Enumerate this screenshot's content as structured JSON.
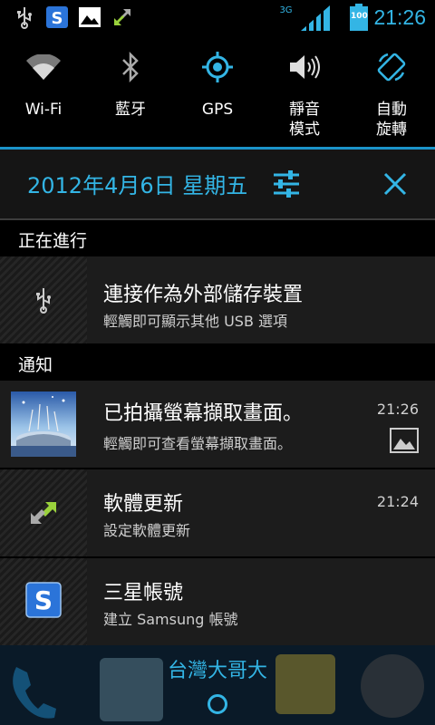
{
  "status_bar": {
    "network": "3G",
    "battery": "100",
    "time": "21:26"
  },
  "toggles": [
    {
      "label": "Wi-Fi",
      "icon": "wifi-icon"
    },
    {
      "label": "藍牙",
      "icon": "bluetooth-icon"
    },
    {
      "label": "GPS",
      "icon": "gps-icon"
    },
    {
      "label": "靜音\n模式",
      "icon": "volume-icon"
    },
    {
      "label": "自動\n旋轉",
      "icon": "rotate-icon"
    }
  ],
  "header": {
    "date": "2012年4月6日 星期五"
  },
  "sections": {
    "ongoing": "正在進行",
    "notifications": "通知"
  },
  "ongoing": [
    {
      "title": "連接作為外部儲存裝置",
      "subtitle": "輕觸即可顯示其他 USB 選項",
      "icon": "usb-icon"
    }
  ],
  "notifications": [
    {
      "title": "已拍攝螢幕擷取畫面。",
      "subtitle": "輕觸即可查看螢幕擷取畫面。",
      "time": "21:26",
      "icon": "screenshot-thumbnail"
    },
    {
      "title": "軟體更新",
      "subtitle": "設定軟體更新",
      "time": "21:24",
      "icon": "update-icon"
    },
    {
      "title": "三星帳號",
      "subtitle": "建立 Samsung 帳號",
      "icon": "samsung-account-icon"
    }
  ],
  "carrier": "台灣大哥大",
  "colors": {
    "accent": "#33b5e5",
    "notification_bg": "#1c1c1c"
  }
}
